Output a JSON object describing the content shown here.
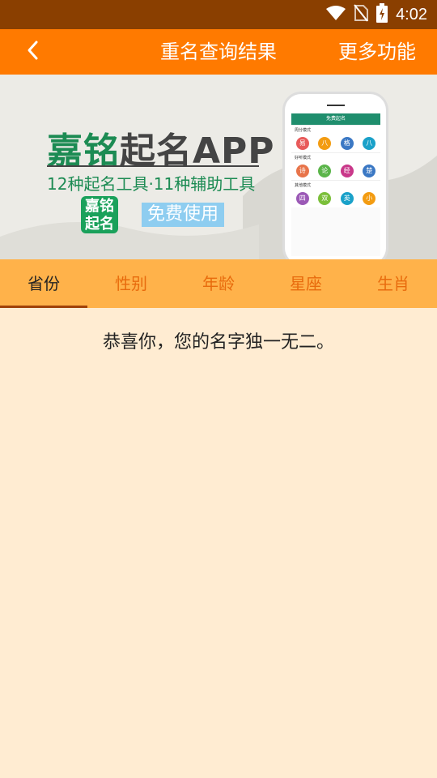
{
  "status_bar": {
    "time": "4:02",
    "icons": [
      "wifi-icon",
      "no-sim-icon",
      "battery-charging-icon"
    ]
  },
  "app_bar": {
    "back_icon": "chevron-left-icon",
    "title": "重名查询结果",
    "more_label": "更多功能"
  },
  "banner": {
    "brand_green": "嘉铭",
    "brand_dark": "起名APP",
    "subline": "12种起名工具·11种辅助工具",
    "badge_line1": "嘉铭",
    "badge_line2": "起名",
    "free_label": "免费使用",
    "phone": {
      "header": "免费起名",
      "sections": [
        {
          "title": "周分模式",
          "items": [
            "易",
            "八",
            "格",
            "八"
          ]
        },
        {
          "title": "好听模式",
          "items": [
            "诗",
            "论",
            "经",
            "楚"
          ]
        },
        {
          "title": "其他模式",
          "items": [
            "四",
            "双",
            "英",
            "小"
          ]
        }
      ]
    }
  },
  "tabs": [
    {
      "label": "省份",
      "active": true
    },
    {
      "label": "性别",
      "active": false
    },
    {
      "label": "年龄",
      "active": false
    },
    {
      "label": "星座",
      "active": false
    },
    {
      "label": "生肖",
      "active": false
    }
  ],
  "result_text": "恭喜你，您的名字独一无二。",
  "colors": {
    "status_bar": "#8a3f00",
    "app_bar": "#ff7a00",
    "tab_bar": "#ffb24a",
    "tab_text": "#e86b0d",
    "background": "#ffecd2",
    "brand_green": "#1c8b53"
  }
}
